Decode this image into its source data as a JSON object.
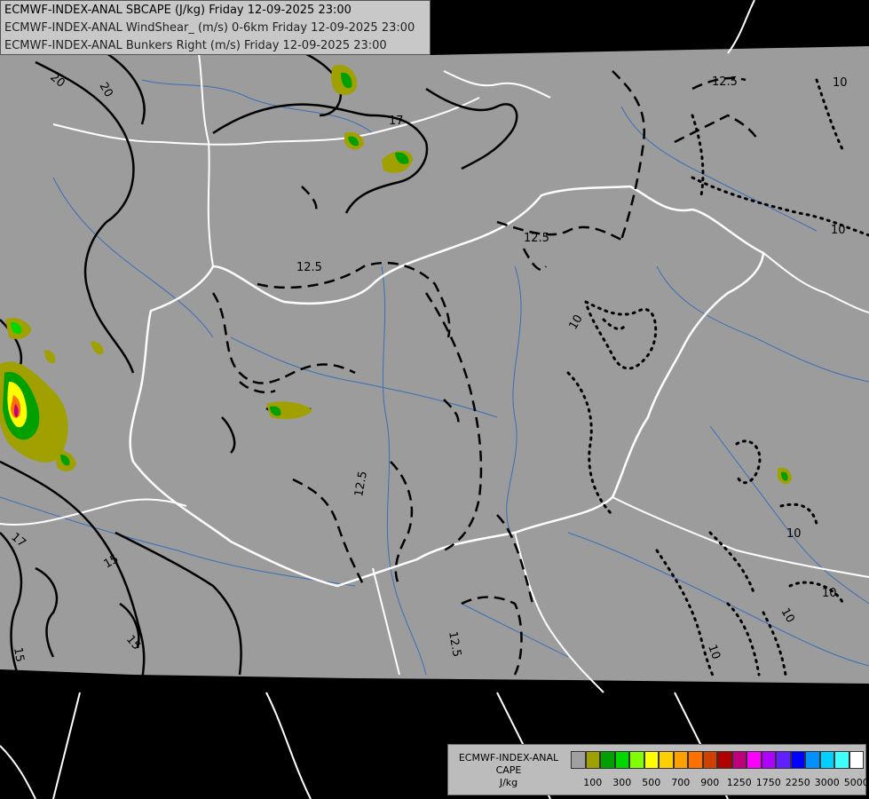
{
  "header": {
    "line1": "ECMWF-INDEX-ANAL SBCAPE (J/kg) Friday 12-09-2025 23:00",
    "line2": "ECMWF-INDEX-ANAL WindShear_ (m/s) 0-6km Friday 12-09-2025 23:00",
    "line3": "ECMWF-INDEX-ANAL Bunkers Right (m/s) Friday 12-09-2025 23:00"
  },
  "contour_labels": [
    "20",
    "20",
    "17",
    "12.5",
    "12.5",
    "12.5",
    "12.5",
    "10",
    "10",
    "10",
    "10",
    "10",
    "15",
    "15",
    "15",
    "17",
    "12.5",
    "10",
    "10"
  ],
  "legend": {
    "line1": "ECMWF-INDEX-ANAL",
    "line2": "CAPE",
    "line3": "J/kg",
    "colors": [
      "#a0a0a0",
      "#a0a000",
      "#00a000",
      "#00d800",
      "#80ff00",
      "#ffff00",
      "#ffd000",
      "#ffa000",
      "#ff7000",
      "#d04000",
      "#b00000",
      "#c0007a",
      "#ff00ff",
      "#b000ff",
      "#6020ff",
      "#0000ff",
      "#0090ff",
      "#00d0ff",
      "#40ffff",
      "#ffffff"
    ],
    "tick_labels": [
      "100",
      "300",
      "500",
      "700",
      "900",
      "1250",
      "1750",
      "2250",
      "3000",
      "5000"
    ]
  },
  "map": {
    "background": "#000000",
    "domain_fill": "#9c9c9c",
    "border_color": "#ffffff",
    "river_color": "#3a6fb8",
    "contour_color": "#000000"
  }
}
